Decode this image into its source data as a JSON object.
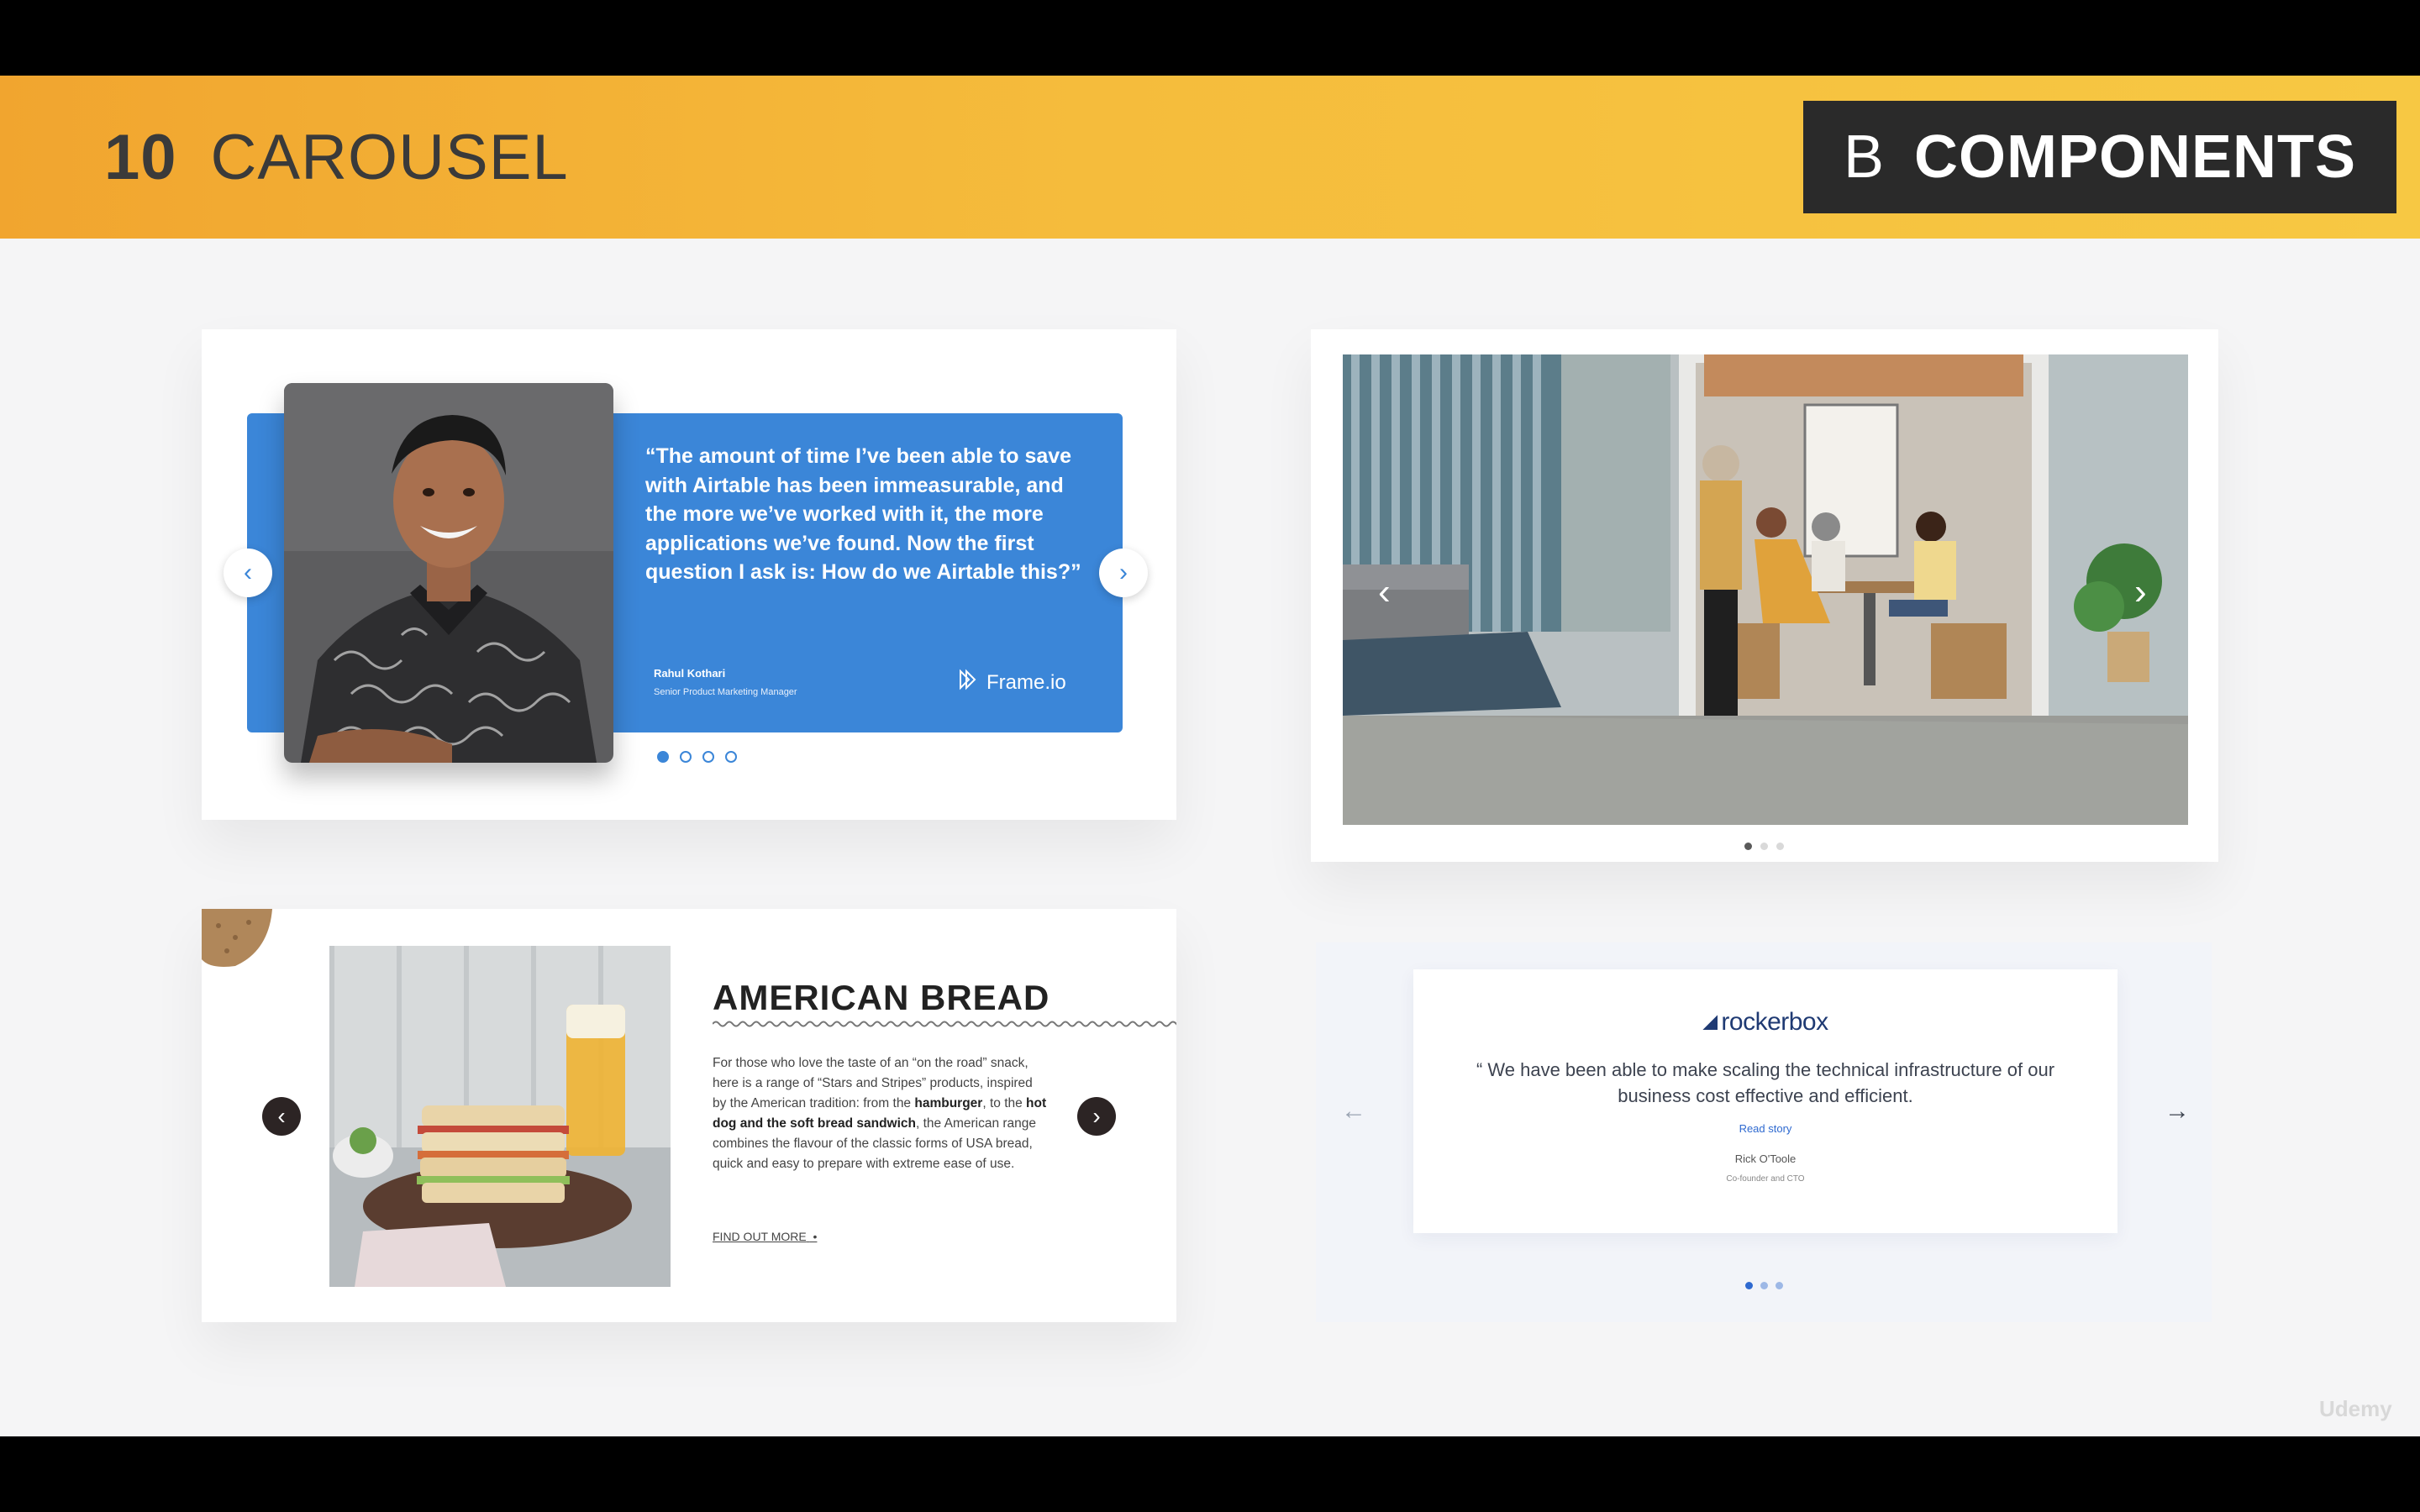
{
  "header": {
    "number": "10",
    "title": "CAROUSEL",
    "badge_letter": "B",
    "badge_text": "COMPONENTS"
  },
  "testimonial_carousel": {
    "quote": "“The amount of time I’ve been able to save with Airtable has been immeasurable, and the more we’ve worked with it, the more applications we’ve found. Now the first question I ask is: How do we Airtable this?”",
    "author_name": "Rahul Kothari",
    "author_role": "Senior Product Marketing Manager",
    "brand": "Frame.io",
    "prev_icon": "chevron-left",
    "next_icon": "chevron-right",
    "slide_count": 4,
    "active_slide": 1,
    "accent_color": "#3b86d8"
  },
  "image_carousel": {
    "prev_icon": "chevron-left",
    "next_icon": "chevron-right",
    "slide_count": 3,
    "active_slide": 1
  },
  "bread_carousel": {
    "title": "AMERICAN BREAD",
    "text_1": "For those who love the taste of an “on the road” snack, here is a range of “Stars and Stripes” products, inspired by the American tradition: from the ",
    "bold_1": "hamburger",
    "text_2": ", to the ",
    "bold_2": "hot dog and the soft bread sandwich",
    "text_3": ", the American range combines the flavour of the classic forms of USA bread, quick and easy to prepare with extreme ease of use.",
    "link": "FIND OUT MORE",
    "prev_icon": "chevron-left",
    "next_icon": "chevron-right"
  },
  "rockerbox_carousel": {
    "logo": "rockerbox",
    "quote": "“ We have been able to make scaling the technical infrastructure of our business cost effective and efficient.",
    "read_link": "Read story",
    "author_name": "Rick O'Toole",
    "author_role": "Co-founder and CTO",
    "prev_icon": "arrow-left",
    "next_icon": "arrow-right",
    "slide_count": 3,
    "active_slide": 1
  },
  "watermark": "Udemy"
}
